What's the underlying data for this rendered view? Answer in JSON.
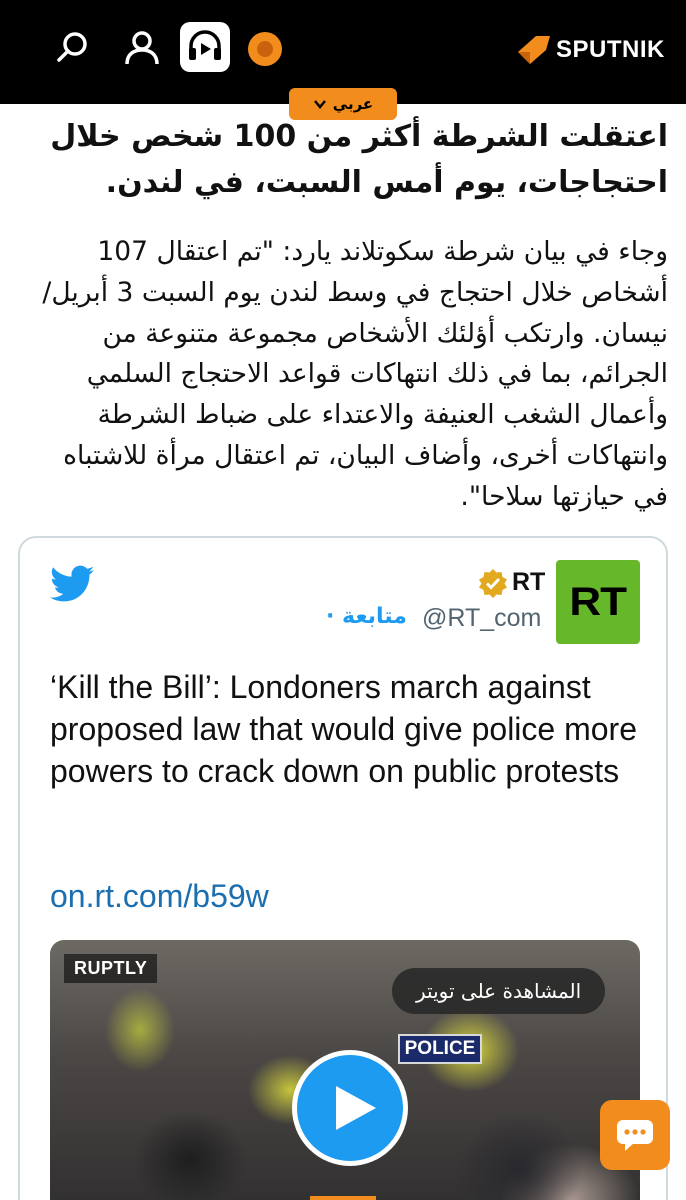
{
  "header": {
    "logo_text": "SPUTNIK",
    "icons": [
      "search-icon",
      "user-icon",
      "audio-icon",
      "orange-dot"
    ],
    "lang_tab": "عربي"
  },
  "article": {
    "headline": "اعتقلت الشرطة أكثر من 100 شخص خلال احتجاجات، يوم أمس السبت، في لندن.",
    "body": "وجاء في بيان شرطة سكوتلاند يارد: \"تم اعتقال 107 أشخاص خلال احتجاج في وسط لندن يوم السبت 3 أبريل/ نيسان. وارتكب أؤلئك الأشخاص مجموعة متنوعة من الجرائم، بما في ذلك انتهاكات قواعد الاحتجاج السلمي وأعمال الشغب العنيفة والاعتداء على ضباط الشرطة وانتهاكات أخرى، وأضاف البيان، تم اعتقال مرأة للاشتباه في حيازتها سلاحا\"."
  },
  "tweet": {
    "avatar_text": "RT",
    "account_name": "RT",
    "handle": "@RT_com",
    "follow_label": "متابعة ·",
    "text": "‘Kill the Bill’: Londoners march against proposed law that would give police more powers to crack down on public protests",
    "link": "on.rt.com/b59w",
    "media": {
      "source_badge": "RUPTLY",
      "police_text": "POLICE",
      "watch_label": "المشاهدة على تويتر"
    }
  },
  "colors": {
    "accent": "#f28d1d",
    "twitter_blue": "#1d9bf0",
    "rt_green": "#67b72b",
    "link_blue": "#1b6fb0"
  }
}
